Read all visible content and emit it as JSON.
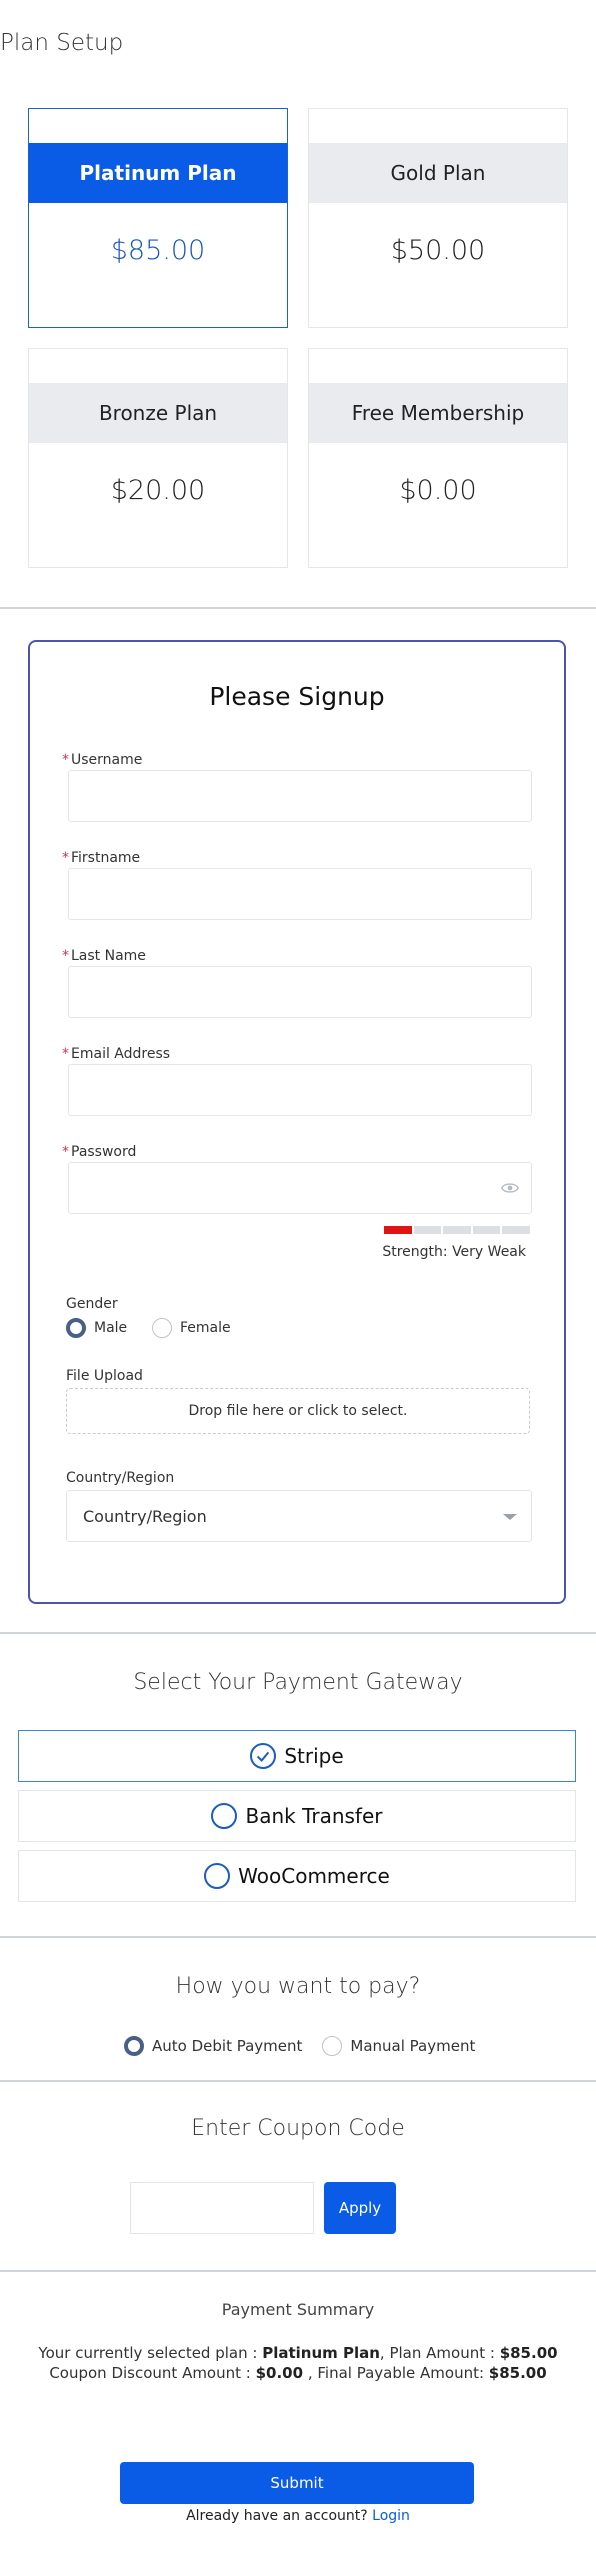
{
  "plan_setup": {
    "title": "Plan Setup",
    "plans": [
      {
        "name": "Platinum Plan",
        "price": "$85.00",
        "selected": true
      },
      {
        "name": "Gold Plan",
        "price": "$50.00",
        "selected": false
      },
      {
        "name": "Bronze Plan",
        "price": "$20.00",
        "selected": false
      },
      {
        "name": "Free Membership",
        "price": "$0.00",
        "selected": false
      }
    ]
  },
  "signup": {
    "title": "Please Signup",
    "required_mark": "*",
    "fields": {
      "username": {
        "label": "Username",
        "value": ""
      },
      "firstname": {
        "label": "Firstname",
        "value": ""
      },
      "lastname": {
        "label": "Last Name",
        "value": ""
      },
      "email": {
        "label": "Email Address",
        "value": ""
      },
      "password": {
        "label": "Password",
        "value": ""
      }
    },
    "password_strength": {
      "text": "Strength: Very Weak",
      "level": 1,
      "max": 5
    },
    "gender": {
      "label": "Gender",
      "options": [
        "Male",
        "Female"
      ],
      "selected": "Male"
    },
    "file_upload": {
      "label": "File Upload",
      "dropzone_text": "Drop file here or click to select."
    },
    "country": {
      "label": "Country/Region",
      "selected": "Country/Region"
    }
  },
  "payment_gateway": {
    "title": "Select Your Payment Gateway",
    "options": [
      "Stripe",
      "Bank Transfer",
      "WooCommerce"
    ],
    "selected": "Stripe"
  },
  "pay_method": {
    "title": "How you want to pay?",
    "options": [
      "Auto Debit Payment",
      "Manual Payment"
    ],
    "selected": "Auto Debit Payment"
  },
  "coupon": {
    "title": "Enter Coupon Code",
    "value": "",
    "apply_label": "Apply"
  },
  "summary": {
    "title": "Payment Summary",
    "selected_plan_prefix": "Your currently selected plan : ",
    "selected_plan": "Platinum Plan",
    "plan_amount_prefix": ", Plan Amount : ",
    "plan_amount": "$85.00",
    "coupon_discount_prefix": "Coupon Discount Amount : ",
    "coupon_discount": "$0.00",
    "final_payable_prefix": " , Final Payable Amount: ",
    "final_payable": "$85.00"
  },
  "footer": {
    "submit_label": "Submit",
    "login_prompt": "Already have an account? ",
    "login_label": "Login"
  },
  "colors": {
    "accent": "#0a5ce6",
    "strength_weak": "#e01414",
    "required": "#e0304b",
    "signup_border": "#4c55a8"
  }
}
